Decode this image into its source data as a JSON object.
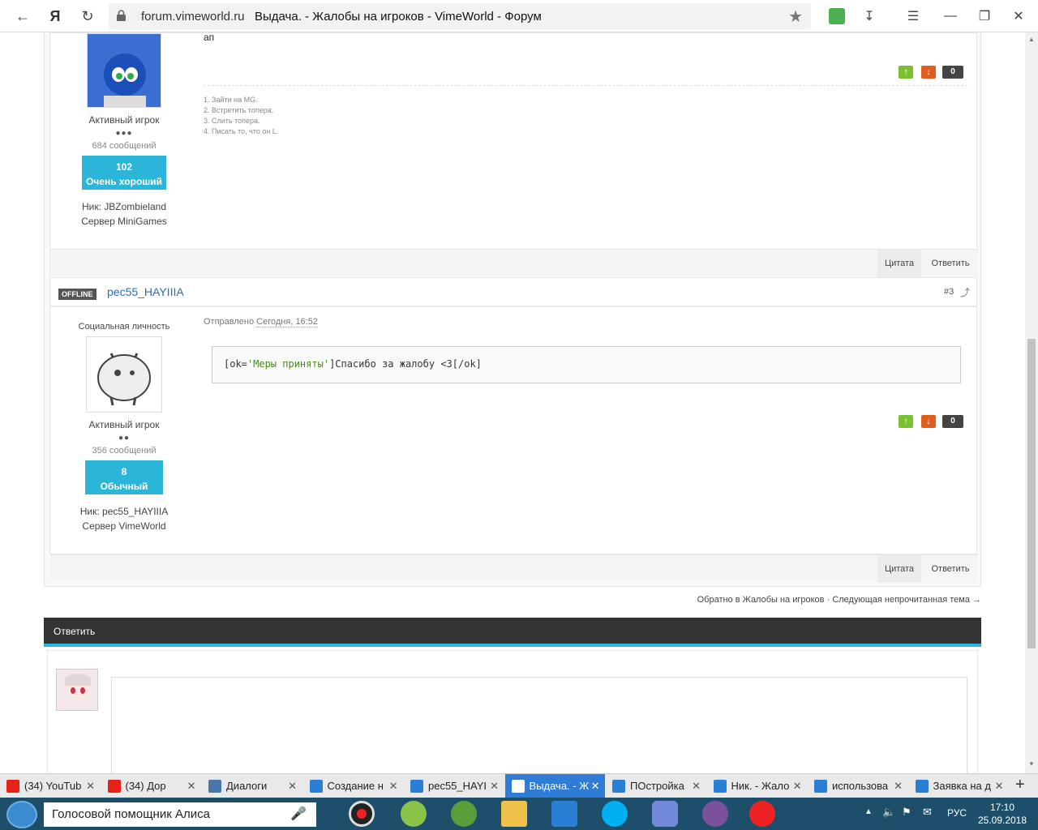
{
  "browser": {
    "domain": "forum.vimeworld.ru",
    "title": "Выдача. - Жалобы на игроков - VimeWorld - Форум",
    "yandex_glyph": "Я"
  },
  "post1": {
    "body": "ап",
    "rank": "Активный игрок",
    "pips": "●●●",
    "msgcount": "684 сообщений",
    "rep_value": "102",
    "rep_label": "Очень хороший",
    "nick": "Ник: JBZombieland",
    "server": "Сервер MiniGames",
    "votes": {
      "count": "0"
    },
    "signature": [
      "1. Зайти на MG.",
      "2. Встретить топера.",
      "3. Слить топера.",
      "4. Писать то, что он L."
    ],
    "quote": "Цитата",
    "reply": "Ответить"
  },
  "post2": {
    "status": "OFFLINE",
    "author": "pec55_HAYIIIA",
    "number": "#3",
    "title": "Социальная личность",
    "sent_prefix": "Отправлено",
    "sent_time": "Сегодня, 16:52",
    "code_attr": "[ok=",
    "code_value": "'Меры приняты'",
    "code_rest": "]Спасибо за жалобу <3[/ok]",
    "rank": "Активный игрок",
    "pips": "●●",
    "msgcount": "356 сообщений",
    "rep_value": "8",
    "rep_label": "Обычный",
    "nick": "Ник: pec55_HAYIIIA",
    "server": "Сервер VimeWorld",
    "votes": {
      "count": "0"
    },
    "quote": "Цитата",
    "reply": "Ответить"
  },
  "footer": {
    "back": "Обратно в Жалобы на игроков",
    "sep": " · ",
    "next": "Следующая непрочитанная тема →"
  },
  "replybar": {
    "label": "Ответить"
  },
  "tabs": [
    {
      "label": "(34) YouTub",
      "icon": "youtube",
      "color": "#e62117"
    },
    {
      "label": "(34) Дор",
      "icon": "youtube",
      "color": "#e62117"
    },
    {
      "label": "Диалоги",
      "icon": "chat",
      "color": "#4a76a8"
    },
    {
      "label": "Создание н",
      "icon": "vimeworld",
      "color": "#2a7fd4"
    },
    {
      "label": "pec55_HAYI",
      "icon": "vimeworld",
      "color": "#2a7fd4"
    },
    {
      "label": "Выдача. - Ж",
      "icon": "vimeworld",
      "color": "#ffffff",
      "active": true
    },
    {
      "label": "ПОстройка",
      "icon": "vimeworld",
      "color": "#2a7fd4"
    },
    {
      "label": "Ник. - Жало",
      "icon": "vimeworld",
      "color": "#2a7fd4"
    },
    {
      "label": "использова",
      "icon": "vimeworld",
      "color": "#2a7fd4"
    },
    {
      "label": "Заявка на д",
      "icon": "vimeworld",
      "color": "#2a7fd4"
    }
  ],
  "taskbar": {
    "alice_label": "Голосовой помощник Алиса",
    "lang": "РУС",
    "time": "17:10",
    "date": "25.09.2018"
  }
}
